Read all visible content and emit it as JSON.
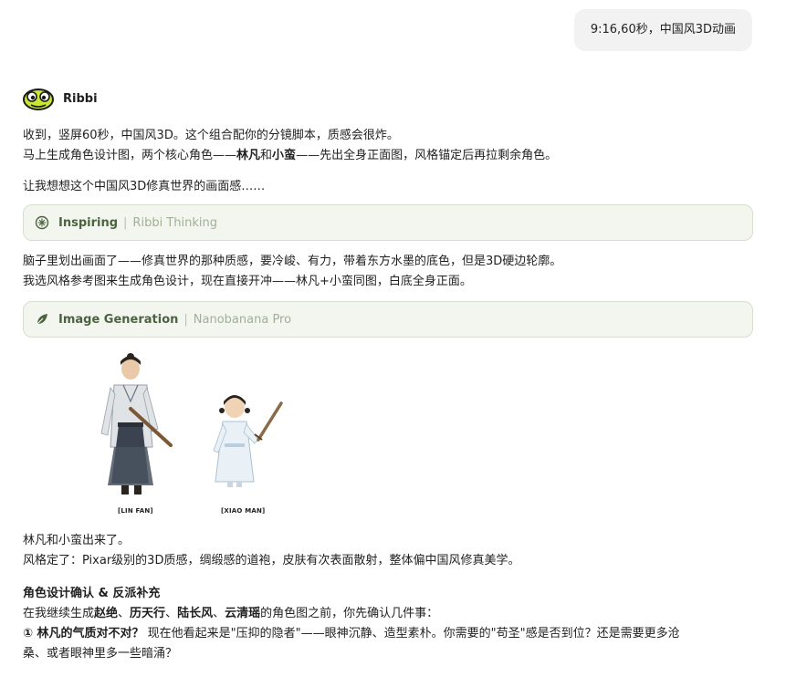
{
  "user_message": "9:16,60秒，中国风3D动画",
  "assistant": {
    "name": "Ribbi",
    "msg1_line1": "收到，竖屏60秒，中国风3D。这个组合配你的分镜脚本，质感会很炸。",
    "msg1_line2_a": "马上生成角色设计图，两个核心角色——",
    "msg1_line2_b1": "林凡",
    "msg1_line2_and": "和",
    "msg1_line2_b2": "小蛮",
    "msg1_line2_c": "——先出全身正面图，风格锚定后再拉剩余角色。",
    "msg2": "让我想想这个中国风3D修真世界的画面感……",
    "tool1": {
      "title": "Inspiring",
      "subtitle": "Ribbi Thinking",
      "icon": "sparkle-icon"
    },
    "msg3_line1": "脑子里划出画面了——修真世界的那种质感，要冷峻、有力，带着东方水墨的底色，但是3D硬边轮廓。",
    "msg3_line2": "我选风格参考图来生成角色设计，现在直接开冲——林凡+小蛮同图，白底全身正面。",
    "tool2": {
      "title": "Image Generation",
      "subtitle": "Nanobanana Pro",
      "icon": "leaf-icon"
    },
    "image_labels": {
      "left": "[LIN FAN]",
      "right": "[XIAO MAN]"
    },
    "msg4_line1": "林凡和小蛮出来了。",
    "msg4_line2": "风格定了：Pixar级别的3D质感，绸缎感的道袍，皮肤有次表面散射，整体偏中国风修真美学。",
    "section_title": "角色设计确认 & 反派补充",
    "msg5_a": "在我继续生成",
    "msg5_b1": "赵绝",
    "msg5_sep1": "、",
    "msg5_b2": "历天行",
    "msg5_sep2": "、",
    "msg5_b3": "陆长风",
    "msg5_sep3": "、",
    "msg5_b4": "云清瑶",
    "msg5_c": "的角色图之前，你先确认几件事：",
    "q1_bold": "① 林凡的气质对不对？",
    "q1_rest": " 现在他看起来是\"压抑的隐者\"——眼神沉静、造型素朴。你需要的\"苟圣\"感是否到位？还是需要更多沧",
    "q1_line2": "桑、或者眼神里多一些暗涌？"
  },
  "colors": {
    "user_bubble": "#f2f2f2",
    "tool_bg": "#f3f6ef",
    "tool_border": "#d6dfcf",
    "tool_title": "#4c6340",
    "tool_subtitle": "#9fb096",
    "avatar_green": "#c8e632"
  }
}
